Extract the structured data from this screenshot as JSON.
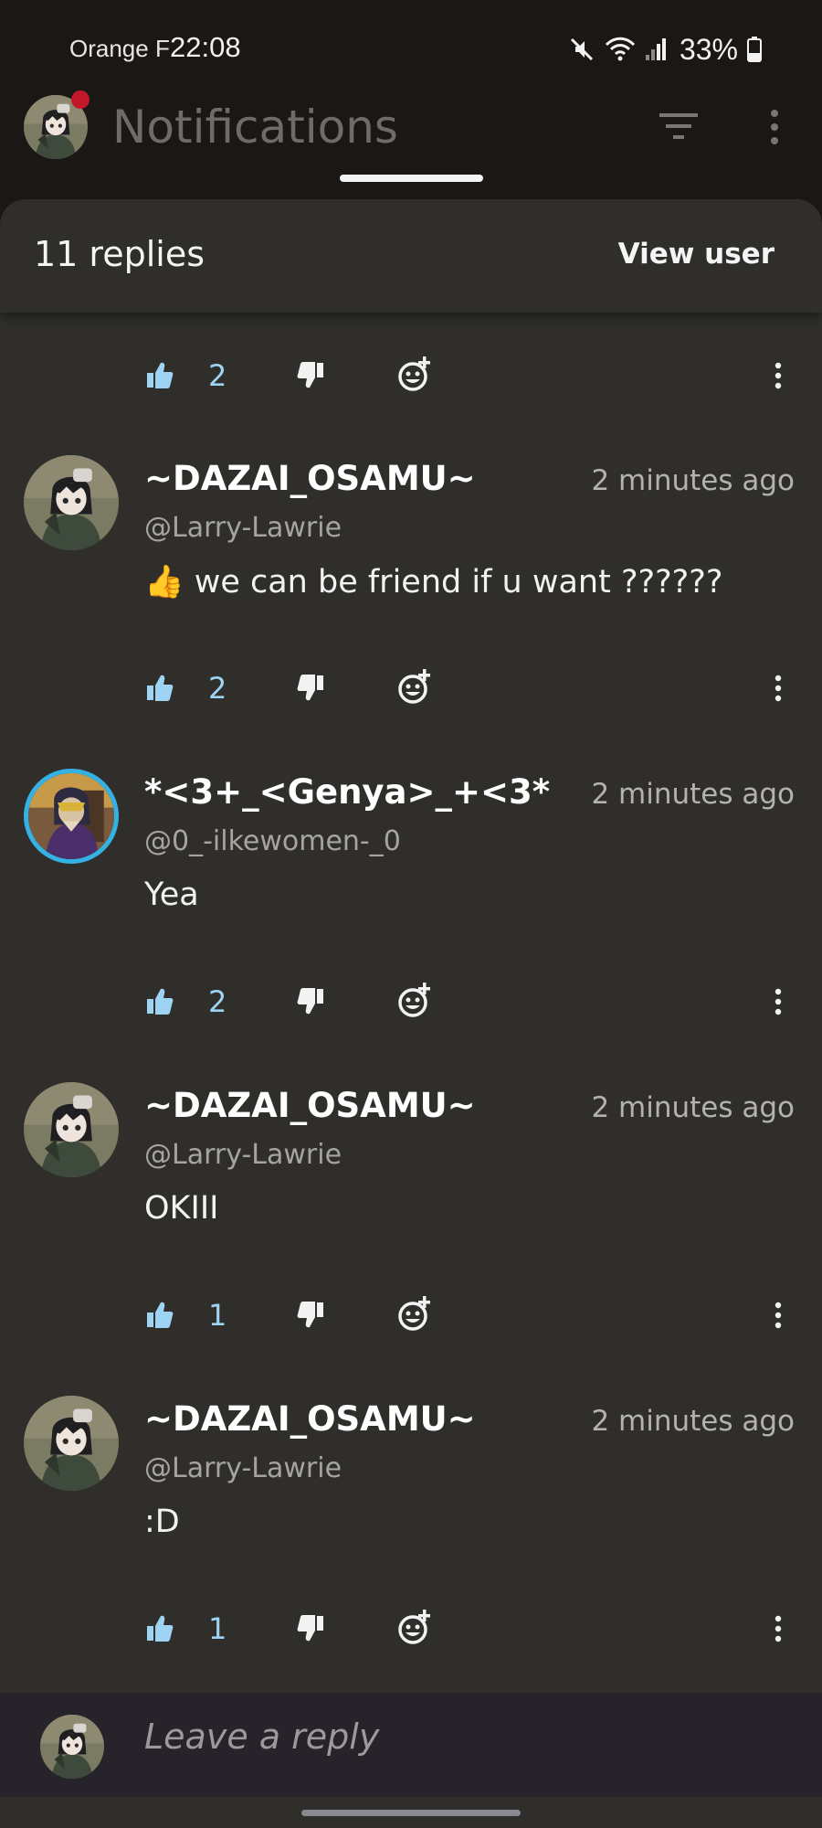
{
  "status_bar": {
    "carrier": "Orange F",
    "time": "22:08",
    "battery": "33%",
    "icons": [
      "mute-icon",
      "wifi-icon",
      "signal-icon",
      "battery-icon"
    ]
  },
  "app_bar": {
    "title": "Notifications",
    "filter_icon": "filter-icon",
    "more_icon": "more-vertical-icon"
  },
  "sheet": {
    "title": "11 replies",
    "view_user_label": "View user"
  },
  "top_action_row": {
    "like_count": "2"
  },
  "comments": [
    {
      "username": "~DAZAI_OSAMU~",
      "handle": "@Larry-Lawrie",
      "time": "2 minutes ago",
      "text": "👍 we can be friend if u want ??????",
      "like_count": "2"
    },
    {
      "username": "*<3+_<Genya>_+<3*",
      "handle": "@0_-ilkewomen-_0",
      "time": "2 minutes ago",
      "text": "Yea",
      "like_count": "2"
    },
    {
      "username": "~DAZAI_OSAMU~",
      "handle": "@Larry-Lawrie",
      "time": "2 minutes ago",
      "text": "OKIII",
      "like_count": "1"
    },
    {
      "username": "~DAZAI_OSAMU~",
      "handle": "@Larry-Lawrie",
      "time": "2 minutes ago",
      "text": ":D",
      "like_count": "1"
    }
  ],
  "reply_bar": {
    "placeholder": "Leave a reply"
  },
  "colors": {
    "background": "#1a1715",
    "sheet": "#2f2e2a",
    "like_count": "#9fd3f4",
    "notification_dot": "#c2182b",
    "reply_bar": "#27232a"
  }
}
